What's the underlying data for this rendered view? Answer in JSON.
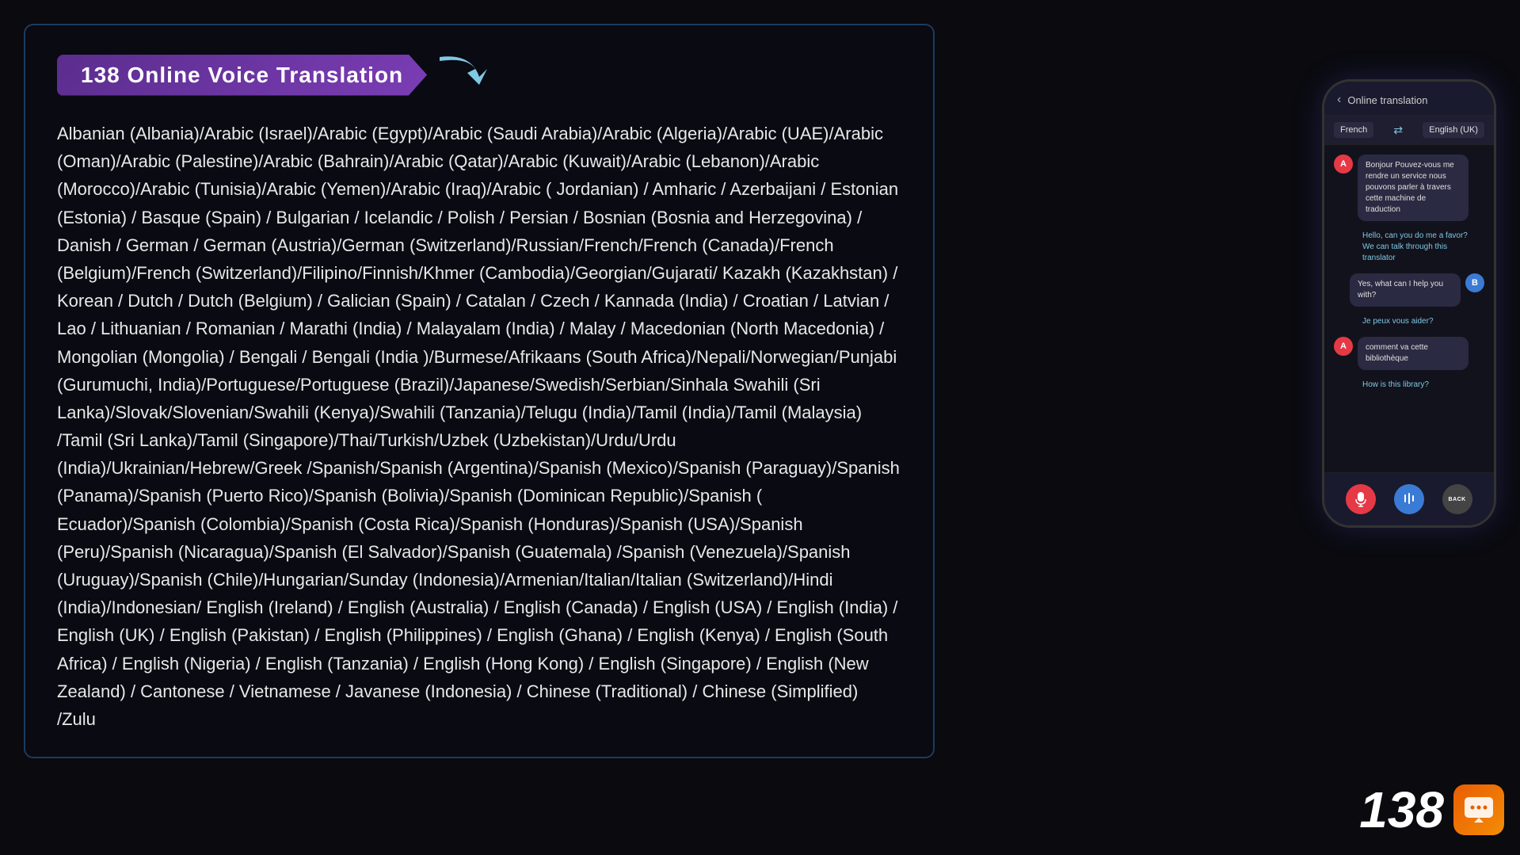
{
  "title": "138 Online Voice Translation",
  "languages_text": "Albanian (Albania)/Arabic (Israel)/Arabic (Egypt)/Arabic (Saudi Arabia)/Arabic (Algeria)/Arabic (UAE)/Arabic (Oman)/Arabic (Palestine)/Arabic (Bahrain)/Arabic (Qatar)/Arabic (Kuwait)/Arabic (Lebanon)/Arabic (Morocco)/Arabic (Tunisia)/Arabic (Yemen)/Arabic (Iraq)/Arabic ( Jordanian) / Amharic / Azerbaijani / Estonian (Estonia) / Basque (Spain) / Bulgarian / Icelandic / Polish / Persian / Bosnian (Bosnia and Herzegovina) / Danish / German / German (Austria)/German (Switzerland)/Russian/French/French (Canada)/French (Belgium)/French (Switzerland)/Filipino/Finnish/Khmer (Cambodia)/Georgian/Gujarati/ Kazakh (Kazakhstan) / Korean / Dutch / Dutch (Belgium) / Galician (Spain) / Catalan / Czech / Kannada (India) / Croatian / Latvian / Lao / Lithuanian / Romanian / Marathi (India) / Malayalam (India) / Malay / Macedonian (North Macedonia) / Mongolian (Mongolia) / Bengali / Bengali (India )/Burmese/Afrikaans (South Africa)/Nepali/Norwegian/Punjabi (Gurumuchi, India)/Portuguese/Portuguese (Brazil)/Japanese/Swedish/Serbian/Sinhala Swahili (Sri Lanka)/Slovak/Slovenian/Swahili (Kenya)/Swahili (Tanzania)/Telugu (India)/Tamil (India)/Tamil (Malaysia) /Tamil (Sri Lanka)/Tamil (Singapore)/Thai/Turkish/Uzbek (Uzbekistan)/Urdu/Urdu (India)/Ukrainian/Hebrew/Greek /Spanish/Spanish (Argentina)/Spanish (Mexico)/Spanish (Paraguay)/Spanish (Panama)/Spanish (Puerto Rico)/Spanish (Bolivia)/Spanish (Dominican Republic)/Spanish ( Ecuador)/Spanish (Colombia)/Spanish (Costa Rica)/Spanish (Honduras)/Spanish (USA)/Spanish (Peru)/Spanish (Nicaragua)/Spanish (El Salvador)/Spanish (Guatemala) /Spanish (Venezuela)/Spanish (Uruguay)/Spanish (Chile)/Hungarian/Sunday (Indonesia)/Armenian/Italian/Italian (Switzerland)/Hindi (India)/Indonesian/ English (Ireland) / English (Australia) / English (Canada) / English (USA) / English (India) / English (UK) / English (Pakistan) / English (Philippines) / English (Ghana) / English (Kenya) / English (South Africa) / English (Nigeria) / English (Tanzania) / English (Hong Kong) / English (Singapore) / English (New Zealand) / Cantonese / Vietnamese / Javanese (Indonesia) / Chinese (Traditional) / Chinese (Simplified) /Zulu",
  "phone": {
    "header": {
      "back_label": "‹",
      "title": "Online translation"
    },
    "lang_from": "French",
    "lang_swap": "⇄",
    "lang_to": "English (UK)",
    "messages": [
      {
        "sender": "A",
        "type": "bubble-dark",
        "text": "Bonjour Pouvez-vous me rendre un service nous pouvons parler à travers cette machine de traduction"
      },
      {
        "sender": "system",
        "type": "bubble-teal",
        "text": "Hello, can you do me a favor? We can talk through this translator"
      },
      {
        "sender": "B",
        "type": "bubble-dark",
        "text": "Yes, what can I help you with?"
      },
      {
        "sender": "system",
        "type": "bubble-teal",
        "text": "Je peux vous aider?"
      },
      {
        "sender": "A",
        "type": "bubble-dark",
        "text": "comment va cette bibliothèque"
      },
      {
        "sender": "system",
        "type": "bubble-teal",
        "text": "How is this library?"
      }
    ],
    "btn_mic_a": "🎤",
    "btn_mic_b": "🎙",
    "btn_back": "BACK"
  },
  "footer": {
    "number": "138",
    "logo_icon": "💬"
  }
}
